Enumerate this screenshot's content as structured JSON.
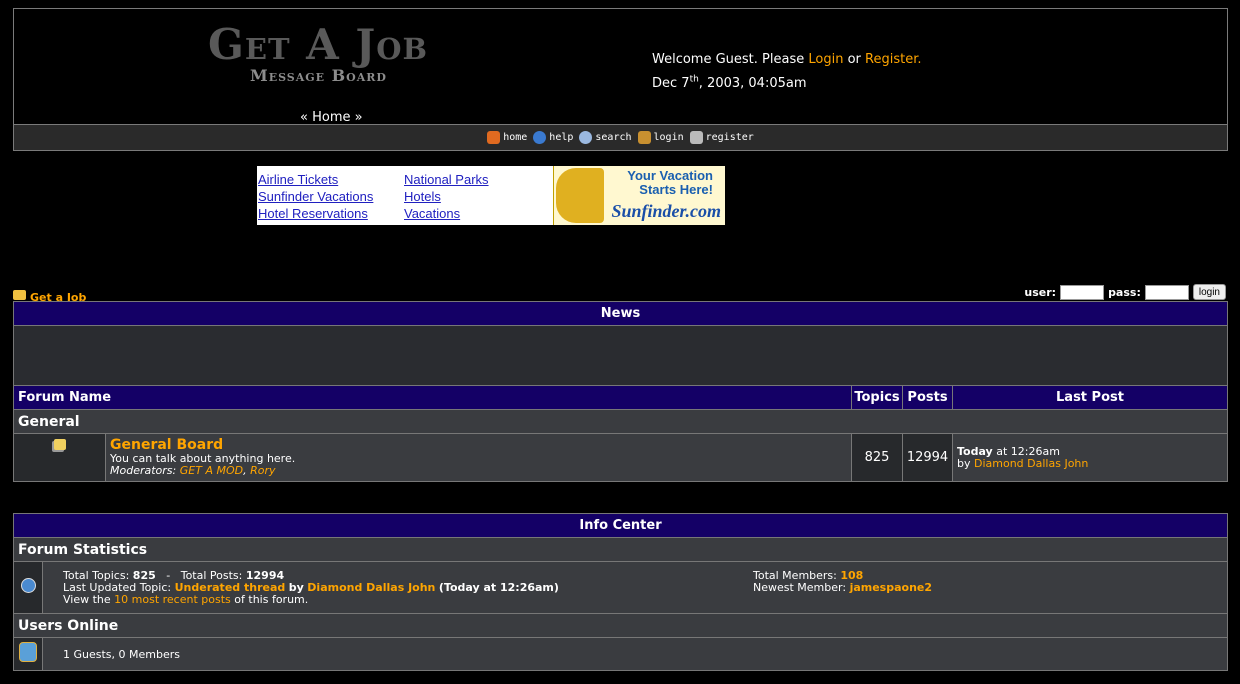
{
  "header": {
    "logo_main": "Get A Job",
    "logo_sub": "Message Board",
    "home_link": "« Home »",
    "welcome_prefix": "Welcome Guest. Please",
    "login_link": "Login",
    "or_text": "or",
    "register_link": "Register.",
    "date_prefix": "Dec 7",
    "date_sup": "th",
    "date_suffix": ", 2003, 04:05am"
  },
  "menu": [
    {
      "label": "home",
      "icon": "home-icon"
    },
    {
      "label": "help",
      "icon": "help-icon"
    },
    {
      "label": "search",
      "icon": "search-icon"
    },
    {
      "label": "login",
      "icon": "login-icon"
    },
    {
      "label": "register",
      "icon": "register-icon"
    }
  ],
  "ad": {
    "col1": [
      "Airline Tickets",
      "Sunfinder Vacations",
      "Hotel Reservations"
    ],
    "col2": [
      "National Parks",
      "Hotels",
      "Vacations"
    ],
    "banner_line1": "Your Vacation",
    "banner_line2": "Starts Here!",
    "banner_brand": "Sunfinder.com"
  },
  "breadcrumb": "Get a Job",
  "login_form": {
    "user_label": "user:",
    "pass_label": "pass:",
    "button": "login"
  },
  "news": {
    "title": "News"
  },
  "forum_table": {
    "headers": [
      "Forum Name",
      "Topics",
      "Posts",
      "Last Post"
    ],
    "category": "General",
    "board": {
      "name": "General Board",
      "description": "You can talk about anything here.",
      "moderators_label": "Moderators:",
      "moderator1": "GET A MOD",
      "moderator2": "Rory",
      "topics": "825",
      "posts": "12994",
      "last_post_day": "Today",
      "last_post_time": "at 12:26am",
      "last_post_by": "by",
      "last_post_user": "Diamond Dallas John"
    }
  },
  "info_center": {
    "title": "Info Center",
    "stats_heading": "Forum Statistics",
    "total_topics_label": "Total Topics:",
    "total_topics": "825",
    "total_posts_label": "Total Posts:",
    "total_posts": "12994",
    "last_updated_label": "Last Updated Topic:",
    "last_updated_topic": "Underated thread",
    "by": "by",
    "last_updated_user": "Diamond Dallas John",
    "last_updated_time": "(Today at 12:26am)",
    "view_prefix": "View the",
    "recent_link": "10 most recent posts",
    "view_suffix": "of this forum.",
    "total_members_label": "Total Members:",
    "total_members": "108",
    "newest_member_label": "Newest Member:",
    "newest_member": "jamespaone2",
    "online_heading": "Users Online",
    "online_text": "1 Guests, 0 Members"
  },
  "colors": {
    "accent": "#ffa500",
    "header_bg": "#140066",
    "row_bg": "#3a3c40",
    "dark_bg": "#27292c"
  }
}
